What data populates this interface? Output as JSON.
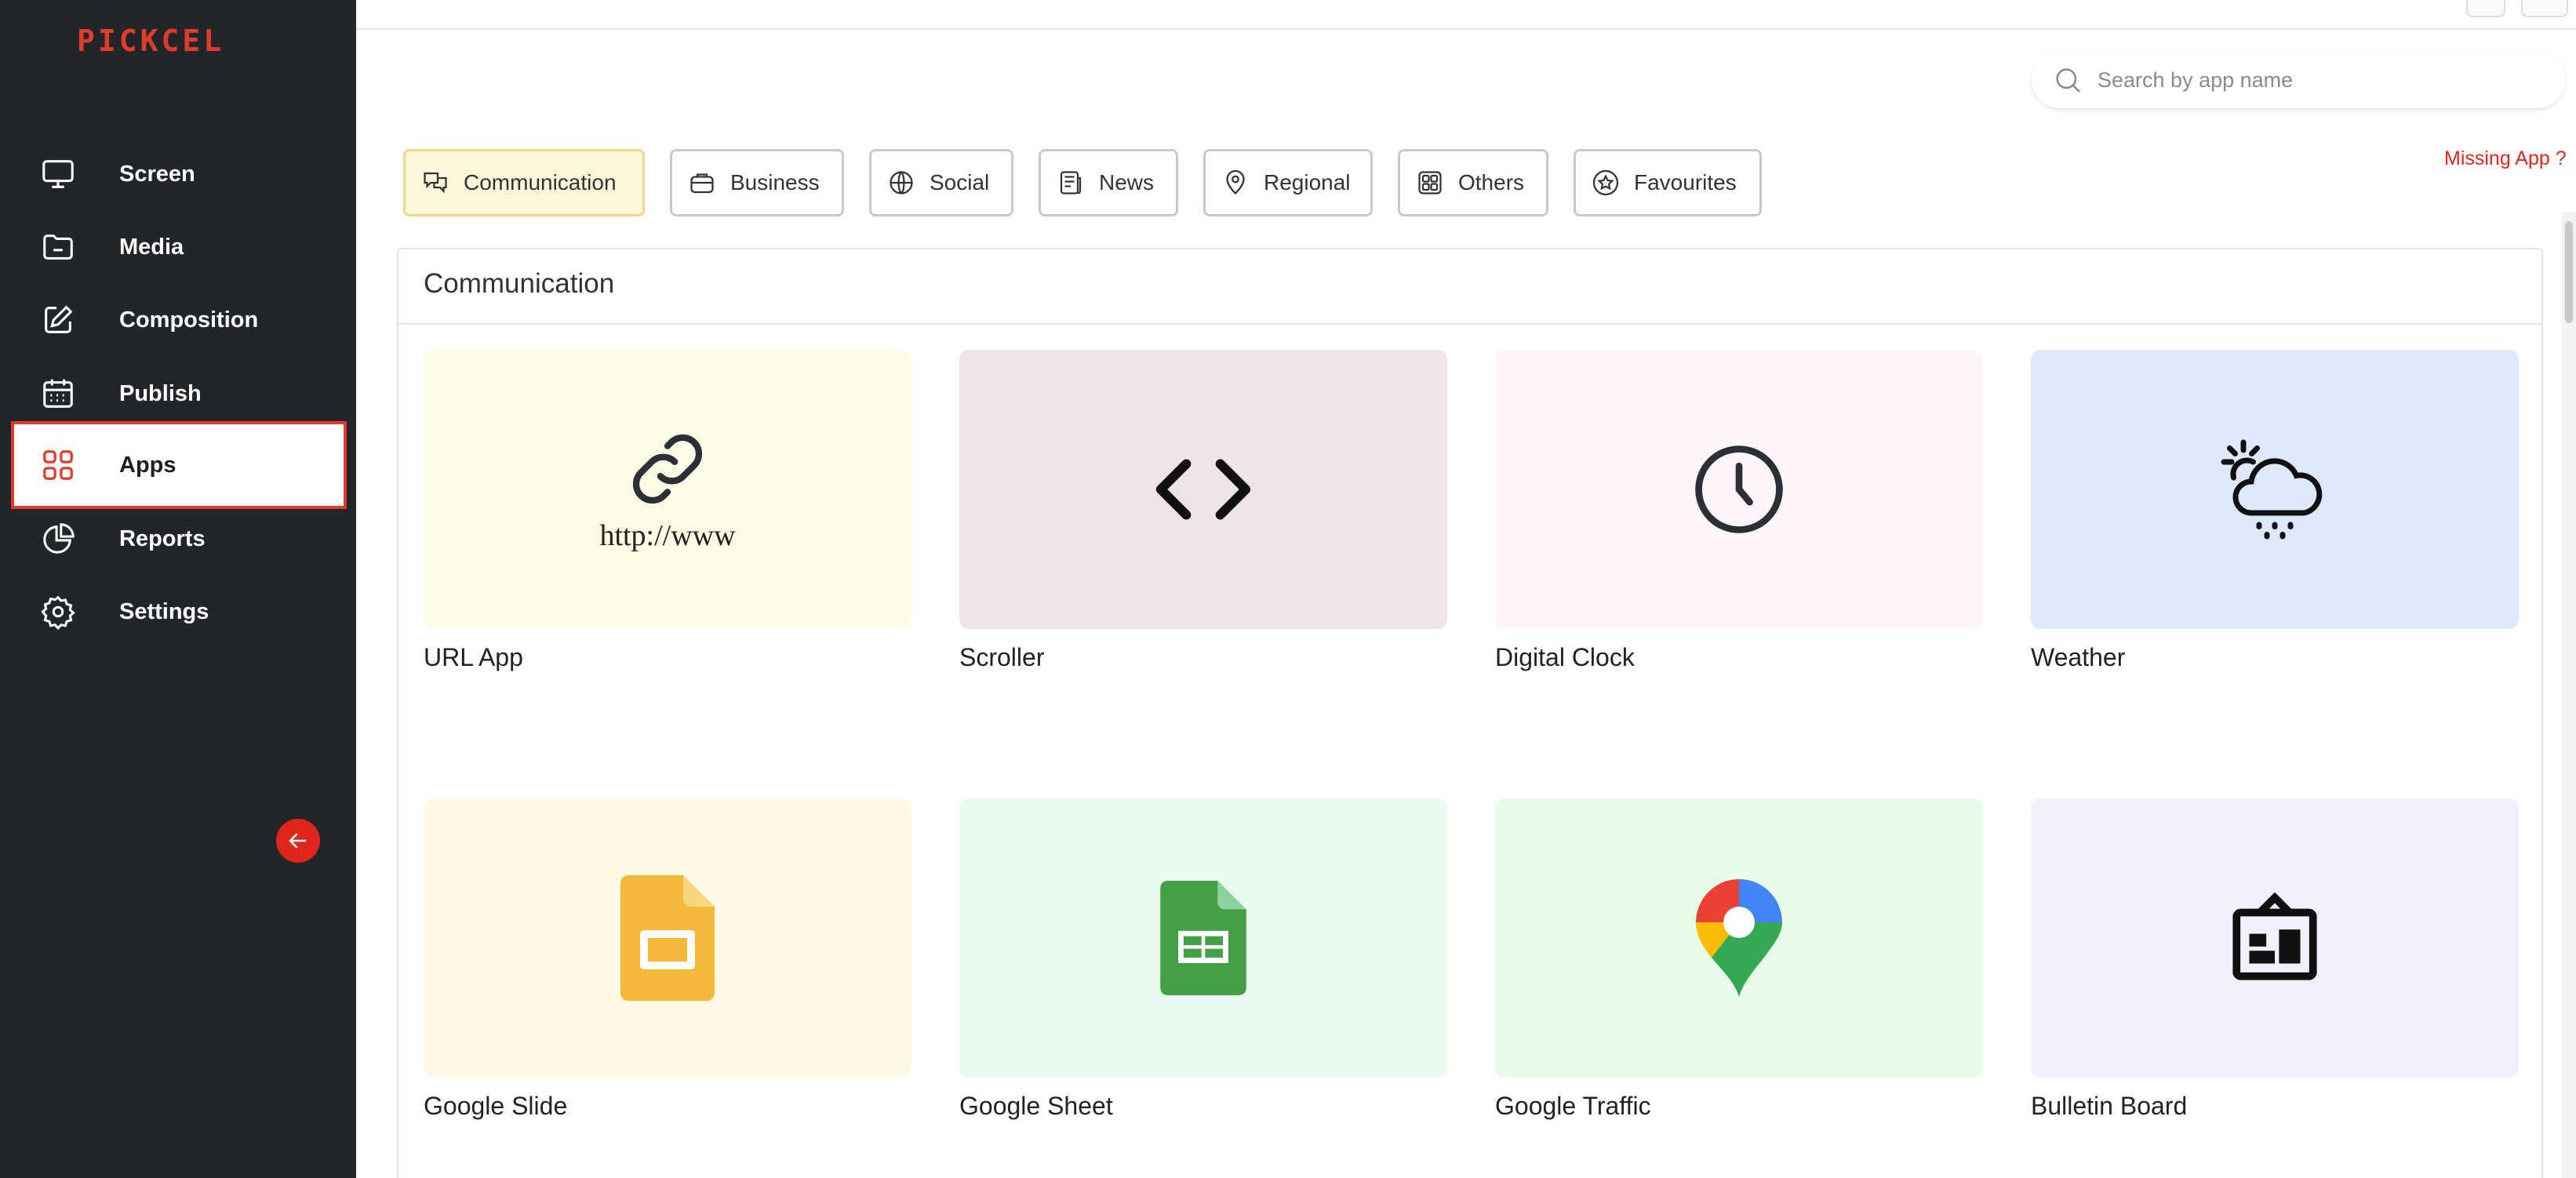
{
  "brand": {
    "logo_text": "PICKCEL",
    "accent": "#e23b2c"
  },
  "sidebar": {
    "items": [
      {
        "label": "Screen",
        "icon": "monitor-icon"
      },
      {
        "label": "Media",
        "icon": "folder-icon"
      },
      {
        "label": "Composition",
        "icon": "edit-icon"
      },
      {
        "label": "Publish",
        "icon": "calendar-icon"
      },
      {
        "label": "Apps",
        "icon": "grid-icon",
        "active": true
      },
      {
        "label": "Reports",
        "icon": "pie-chart-icon"
      },
      {
        "label": "Settings",
        "icon": "gear-icon"
      }
    ],
    "collapse_icon": "arrow-left-icon"
  },
  "search": {
    "placeholder": "Search by app name",
    "value": ""
  },
  "missing_link": "Missing App ?",
  "tabs": [
    {
      "label": "Communication",
      "icon": "chat-icon",
      "active": true
    },
    {
      "label": "Business",
      "icon": "briefcase-icon"
    },
    {
      "label": "Social",
      "icon": "globe-icon"
    },
    {
      "label": "News",
      "icon": "newspaper-icon"
    },
    {
      "label": "Regional",
      "icon": "location-pin-icon"
    },
    {
      "label": "Others",
      "icon": "grid-icon"
    },
    {
      "label": "Favourites",
      "icon": "star-icon"
    }
  ],
  "panel": {
    "title": "Communication",
    "apps": [
      {
        "name": "URL App",
        "icon": "link-icon",
        "thumb_text": "http://www",
        "bg": "#fdfae6"
      },
      {
        "name": "Scroller",
        "icon": "code-icon",
        "bg": "#efe3ea"
      },
      {
        "name": "Digital Clock",
        "icon": "clock-icon",
        "bg": "#fdf5f7"
      },
      {
        "name": "Weather",
        "icon": "weather-icon",
        "bg": "#dde9fb"
      },
      {
        "name": "Google Slide",
        "icon": "google-slides-icon",
        "bg": "#fef8e6"
      },
      {
        "name": "Google Sheet",
        "icon": "google-sheets-icon",
        "bg": "#e8fbee"
      },
      {
        "name": "Google Traffic",
        "icon": "google-maps-icon",
        "bg": "#e6fce8"
      },
      {
        "name": "Bulletin Board",
        "icon": "bulletin-board-icon",
        "bg": "#f3effc"
      }
    ]
  }
}
